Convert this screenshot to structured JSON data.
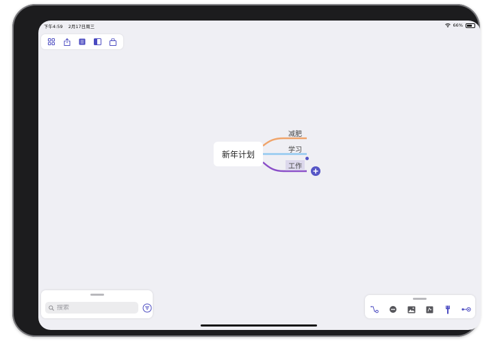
{
  "status_bar": {
    "time": "下午4:59",
    "date": "2月17日周三",
    "battery": "66%",
    "battery_level": 0.66
  },
  "toolbar": {
    "icons": [
      "grid-view-icon",
      "share-icon",
      "outline-list-icon",
      "sidebar-toggle-icon",
      "store-bag-icon"
    ]
  },
  "mindmap": {
    "central_topic": "新年计划",
    "topics": [
      {
        "label": "减肥",
        "color": "#f0a46a"
      },
      {
        "label": "学习",
        "color": "#90c8f0"
      },
      {
        "label": "工作",
        "color": "#8a4ec8",
        "selected": true
      }
    ],
    "accent": "#5656c6"
  },
  "search": {
    "placeholder": "搜索",
    "value": ""
  },
  "format_panel": {
    "icons": [
      "relationship-icon",
      "collapse-icon",
      "image-icon",
      "sticker-icon",
      "style-brush-icon",
      "connect-icon"
    ]
  }
}
